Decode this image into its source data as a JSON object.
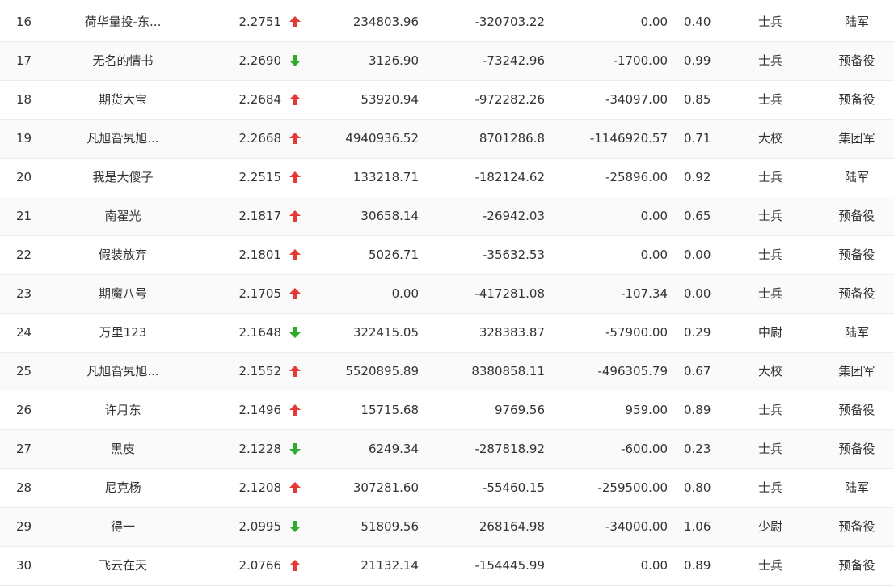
{
  "colors": {
    "up": "#e53935",
    "down": "#2eaa2e",
    "text": "#333333",
    "row_alt": "#fafafa",
    "divider": "#ececec"
  },
  "rows": [
    {
      "rank": "16",
      "name": "荷华量投-东...",
      "score": "2.2751",
      "trend": "up",
      "v1": "234803.96",
      "v2": "-320703.22",
      "v3": "0.00",
      "ratio": "0.40",
      "title": "士兵",
      "army": "陆军"
    },
    {
      "rank": "17",
      "name": "无名的情书",
      "score": "2.2690",
      "trend": "down",
      "v1": "3126.90",
      "v2": "-73242.96",
      "v3": "-1700.00",
      "ratio": "0.99",
      "title": "士兵",
      "army": "预备役"
    },
    {
      "rank": "18",
      "name": "期货大宝",
      "score": "2.2684",
      "trend": "up",
      "v1": "53920.94",
      "v2": "-972282.26",
      "v3": "-34097.00",
      "ratio": "0.85",
      "title": "士兵",
      "army": "预备役"
    },
    {
      "rank": "19",
      "name": "凡旭旮旯旭...",
      "score": "2.2668",
      "trend": "up",
      "v1": "4940936.52",
      "v2": "8701286.8",
      "v3": "-1146920.57",
      "ratio": "0.71",
      "title": "大校",
      "army": "集团军"
    },
    {
      "rank": "20",
      "name": "我是大傻子",
      "score": "2.2515",
      "trend": "up",
      "v1": "133218.71",
      "v2": "-182124.62",
      "v3": "-25896.00",
      "ratio": "0.92",
      "title": "士兵",
      "army": "陆军"
    },
    {
      "rank": "21",
      "name": "南翟光",
      "score": "2.1817",
      "trend": "up",
      "v1": "30658.14",
      "v2": "-26942.03",
      "v3": "0.00",
      "ratio": "0.65",
      "title": "士兵",
      "army": "预备役"
    },
    {
      "rank": "22",
      "name": "假装放弃",
      "score": "2.1801",
      "trend": "up",
      "v1": "5026.71",
      "v2": "-35632.53",
      "v3": "0.00",
      "ratio": "0.00",
      "title": "士兵",
      "army": "预备役"
    },
    {
      "rank": "23",
      "name": "期魔八号",
      "score": "2.1705",
      "trend": "up",
      "v1": "0.00",
      "v2": "-417281.08",
      "v3": "-107.34",
      "ratio": "0.00",
      "title": "士兵",
      "army": "预备役"
    },
    {
      "rank": "24",
      "name": "万里123",
      "score": "2.1648",
      "trend": "down",
      "v1": "322415.05",
      "v2": "328383.87",
      "v3": "-57900.00",
      "ratio": "0.29",
      "title": "中尉",
      "army": "陆军"
    },
    {
      "rank": "25",
      "name": "凡旭旮旯旭...",
      "score": "2.1552",
      "trend": "up",
      "v1": "5520895.89",
      "v2": "8380858.11",
      "v3": "-496305.79",
      "ratio": "0.67",
      "title": "大校",
      "army": "集团军"
    },
    {
      "rank": "26",
      "name": "许月东",
      "score": "2.1496",
      "trend": "up",
      "v1": "15715.68",
      "v2": "9769.56",
      "v3": "959.00",
      "ratio": "0.89",
      "title": "士兵",
      "army": "预备役"
    },
    {
      "rank": "27",
      "name": "黑皮",
      "score": "2.1228",
      "trend": "down",
      "v1": "6249.34",
      "v2": "-287818.92",
      "v3": "-600.00",
      "ratio": "0.23",
      "title": "士兵",
      "army": "预备役"
    },
    {
      "rank": "28",
      "name": "尼克杨",
      "score": "2.1208",
      "trend": "up",
      "v1": "307281.60",
      "v2": "-55460.15",
      "v3": "-259500.00",
      "ratio": "0.80",
      "title": "士兵",
      "army": "陆军"
    },
    {
      "rank": "29",
      "name": "得一",
      "score": "2.0995",
      "trend": "down",
      "v1": "51809.56",
      "v2": "268164.98",
      "v3": "-34000.00",
      "ratio": "1.06",
      "title": "少尉",
      "army": "预备役"
    },
    {
      "rank": "30",
      "name": "飞云在天",
      "score": "2.0766",
      "trend": "up",
      "v1": "21132.14",
      "v2": "-154445.99",
      "v3": "0.00",
      "ratio": "0.89",
      "title": "士兵",
      "army": "预备役"
    }
  ]
}
